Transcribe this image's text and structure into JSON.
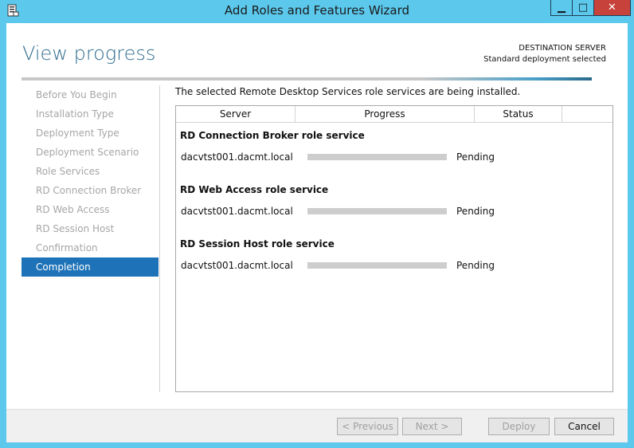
{
  "window": {
    "title": "Add Roles and Features Wizard",
    "controls": {
      "minimize": "▁",
      "maximize": "□",
      "close": "✕"
    }
  },
  "header": {
    "page_title": "View progress",
    "destination_label": "DESTINATION SERVER",
    "destination_value": "Standard deployment selected"
  },
  "nav": {
    "items": [
      {
        "label": "Before You Begin",
        "active": false
      },
      {
        "label": "Installation Type",
        "active": false
      },
      {
        "label": "Deployment Type",
        "active": false
      },
      {
        "label": "Deployment Scenario",
        "active": false
      },
      {
        "label": "Role Services",
        "active": false
      },
      {
        "label": "RD Connection Broker",
        "active": false
      },
      {
        "label": "RD Web Access",
        "active": false
      },
      {
        "label": "RD Session Host",
        "active": false
      },
      {
        "label": "Confirmation",
        "active": false
      },
      {
        "label": "Completion",
        "active": true
      }
    ]
  },
  "main": {
    "description": "The selected Remote Desktop Services role services are being installed.",
    "columns": [
      "Server",
      "Progress",
      "Status"
    ],
    "groups": [
      {
        "title": "RD Connection Broker role service",
        "server": "dacvtst001.dacmt.local",
        "progress": 0,
        "status": "Pending"
      },
      {
        "title": "RD Web Access role service",
        "server": "dacvtst001.dacmt.local",
        "progress": 0,
        "status": "Pending"
      },
      {
        "title": "RD Session Host role service",
        "server": "dacvtst001.dacmt.local",
        "progress": 0,
        "status": "Pending"
      }
    ]
  },
  "footer": {
    "previous": "< Previous",
    "next": "Next >",
    "deploy": "Deploy",
    "cancel": "Cancel"
  },
  "colors": {
    "titlebar": "#5bc8ec",
    "accent": "#1e73b8",
    "page_title": "#316e8f",
    "close_button": "#c7423a",
    "progress_track": "#cdcdcd"
  }
}
